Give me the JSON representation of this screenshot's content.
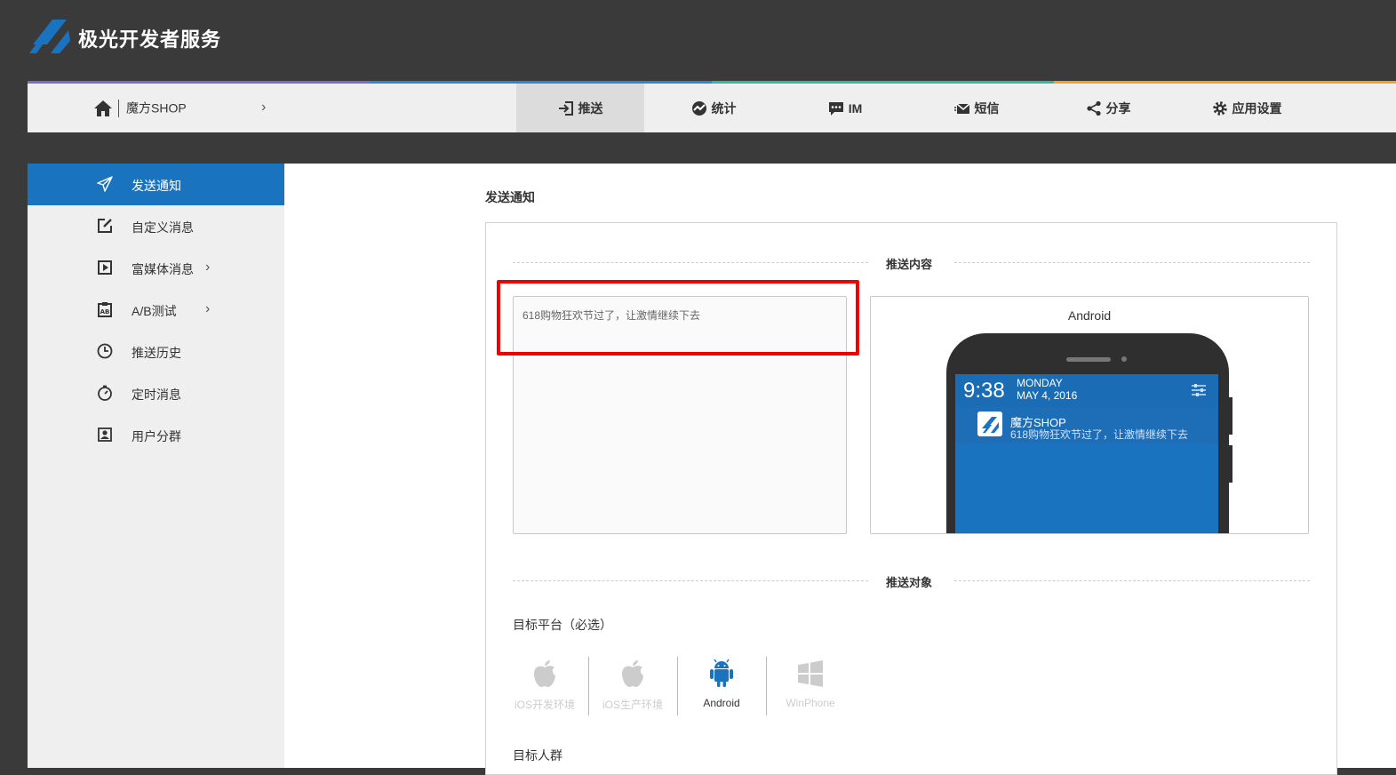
{
  "brand": {
    "title": "极光开发者服务"
  },
  "stripes": [
    "#7b6cc4",
    "#2f86cf",
    "#3ab3a0",
    "#f0a030"
  ],
  "navbar": {
    "app_name": "魔方SHOP",
    "tabs": [
      {
        "label": "推送",
        "icon": "push-icon",
        "active": true
      },
      {
        "label": "统计",
        "icon": "stats-icon",
        "active": false
      },
      {
        "label": "IM",
        "icon": "chat-icon",
        "active": false
      },
      {
        "label": "短信",
        "icon": "sms-icon",
        "active": false
      },
      {
        "label": "分享",
        "icon": "share-icon",
        "active": false
      },
      {
        "label": "应用设置",
        "icon": "gear-icon",
        "active": false
      }
    ]
  },
  "sidebar": {
    "items": [
      {
        "label": "发送通知",
        "icon": "send-icon",
        "active": true
      },
      {
        "label": "自定义消息",
        "icon": "edit-icon"
      },
      {
        "label": "富媒体消息",
        "icon": "media-icon",
        "has_arrow": true
      },
      {
        "label": "A/B测试",
        "icon": "ab-test-icon",
        "has_arrow": true
      },
      {
        "label": "推送历史",
        "icon": "clock-icon"
      },
      {
        "label": "定时消息",
        "icon": "timer-icon"
      },
      {
        "label": "用户分群",
        "icon": "user-group-icon"
      }
    ]
  },
  "main": {
    "title": "发送通知",
    "content_section": "推送内容",
    "message_text": "618购物狂欢节过了，让激情继续下去",
    "preview": {
      "platform": "Android",
      "time": "9:38",
      "day": "MONDAY",
      "date": "MAY 4, 2016",
      "app": "魔方SHOP",
      "body": "618购物狂欢节过了，让激情继续下去"
    },
    "target_section": "推送对象",
    "platform_label": "目标平台（必选）",
    "platforms": [
      {
        "label": "iOS开发环境",
        "icon": "apple-icon",
        "selected": false
      },
      {
        "label": "iOS生产环境",
        "icon": "apple-icon",
        "selected": false
      },
      {
        "label": "Android",
        "icon": "android-icon",
        "selected": true
      },
      {
        "label": "WinPhone",
        "icon": "windows-icon",
        "selected": false
      }
    ],
    "audience_label": "目标人群"
  },
  "colors": {
    "accent": "#1a73bf",
    "highlight": "#f10000",
    "dark": "#3a3a3a"
  }
}
